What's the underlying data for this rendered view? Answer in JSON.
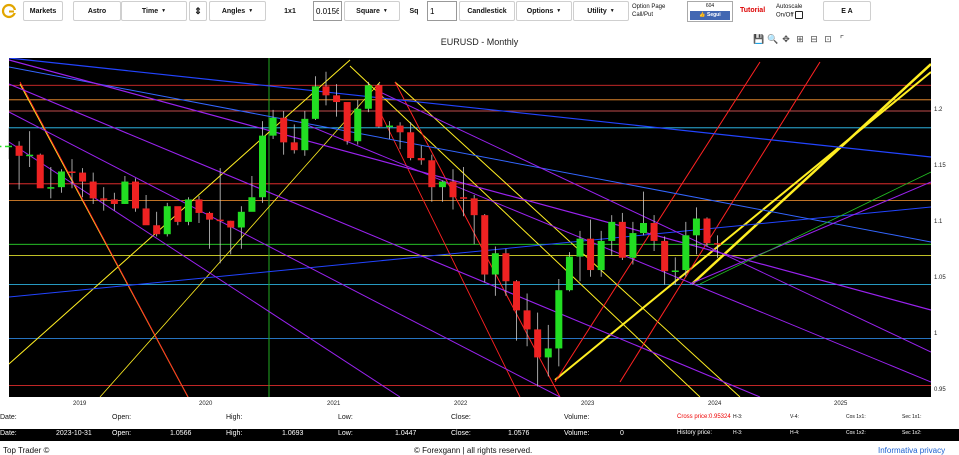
{
  "toolbar": {
    "markets": "Markets",
    "astro": "Astro",
    "time": "Time",
    "stepper": "⇕",
    "angles": "Angles",
    "ratio": "1x1",
    "ratio_value": "0.01562",
    "square": "Square",
    "sq_label": "Sq",
    "sq_value": "1",
    "candlestick": "Candlestick",
    "options": "Options",
    "utility": "Utility",
    "option_page_line1": "Option Page",
    "option_page_line2": "Call/Put",
    "fb_count": "604",
    "fb_button": "👍 Segui",
    "tutorial": "Tutorial",
    "autoscale_line1": "Autoscale",
    "autoscale_line2": "On/Off",
    "ea": "E A"
  },
  "chart": {
    "title": "EURUSD - Monthly",
    "tools": [
      "💾",
      "🔍",
      "✥",
      "⊞",
      "⊟",
      "⊡",
      "⌜"
    ]
  },
  "chart_data": {
    "type": "candlestick",
    "symbol": "EURUSD",
    "timeframe": "Monthly",
    "y_ticks": [
      "1.2",
      "1.15",
      "1.1",
      "1.05",
      "1",
      "0.95"
    ],
    "x_ticks": [
      "2019",
      "2020",
      "2021",
      "2022",
      "2023",
      "2024",
      "2025"
    ],
    "ylim": [
      0.945,
      1.245
    ],
    "x_range": [
      "2018-04",
      "2025-12"
    ],
    "candles": [
      {
        "t": "2018-05",
        "o": 1.169,
        "h": 1.182,
        "l": 1.152,
        "c": 1.169
      },
      {
        "t": "2018-06",
        "o": 1.169,
        "h": 1.18,
        "l": 1.151,
        "c": 1.169
      },
      {
        "t": "2018-07",
        "o": 1.169,
        "h": 1.185,
        "l": 1.157,
        "c": 1.169
      },
      {
        "t": "2018-08",
        "o": 1.169,
        "h": 1.173,
        "l": 1.13,
        "c": 1.16
      },
      {
        "t": "2018-09",
        "o": 1.16,
        "h": 1.182,
        "l": 1.15,
        "c": 1.161
      },
      {
        "t": "2018-10",
        "o": 1.161,
        "h": 1.162,
        "l": 1.132,
        "c": 1.131
      },
      {
        "t": "2018-11",
        "o": 1.131,
        "h": 1.15,
        "l": 1.122,
        "c": 1.132
      },
      {
        "t": "2018-12",
        "o": 1.132,
        "h": 1.148,
        "l": 1.127,
        "c": 1.146
      },
      {
        "t": "2019-01",
        "o": 1.146,
        "h": 1.157,
        "l": 1.131,
        "c": 1.145
      },
      {
        "t": "2019-02",
        "o": 1.145,
        "h": 1.149,
        "l": 1.123,
        "c": 1.137
      },
      {
        "t": "2019-03",
        "o": 1.137,
        "h": 1.145,
        "l": 1.117,
        "c": 1.122
      },
      {
        "t": "2019-04",
        "o": 1.122,
        "h": 1.132,
        "l": 1.111,
        "c": 1.121
      },
      {
        "t": "2019-05",
        "o": 1.121,
        "h": 1.127,
        "l": 1.111,
        "c": 1.117
      },
      {
        "t": "2019-06",
        "o": 1.117,
        "h": 1.142,
        "l": 1.117,
        "c": 1.137
      },
      {
        "t": "2019-07",
        "o": 1.137,
        "h": 1.14,
        "l": 1.11,
        "c": 1.113
      },
      {
        "t": "2019-08",
        "o": 1.113,
        "h": 1.125,
        "l": 1.103,
        "c": 1.098
      },
      {
        "t": "2019-09",
        "o": 1.098,
        "h": 1.11,
        "l": 1.088,
        "c": 1.09
      },
      {
        "t": "2019-10",
        "o": 1.09,
        "h": 1.118,
        "l": 1.088,
        "c": 1.115
      },
      {
        "t": "2019-11",
        "o": 1.115,
        "h": 1.114,
        "l": 1.098,
        "c": 1.101
      },
      {
        "t": "2019-12",
        "o": 1.101,
        "h": 1.123,
        "l": 1.098,
        "c": 1.121
      },
      {
        "t": "2020-01",
        "o": 1.121,
        "h": 1.124,
        "l": 1.1,
        "c": 1.109
      },
      {
        "t": "2020-02",
        "o": 1.109,
        "h": 1.11,
        "l": 1.077,
        "c": 1.103
      },
      {
        "t": "2020-03",
        "o": 1.103,
        "h": 1.149,
        "l": 1.064,
        "c": 1.102
      },
      {
        "t": "2020-04",
        "o": 1.102,
        "h": 1.102,
        "l": 1.072,
        "c": 1.096
      },
      {
        "t": "2020-05",
        "o": 1.096,
        "h": 1.115,
        "l": 1.077,
        "c": 1.11
      },
      {
        "t": "2020-06",
        "o": 1.11,
        "h": 1.142,
        "l": 1.117,
        "c": 1.123
      },
      {
        "t": "2020-07",
        "o": 1.123,
        "h": 1.191,
        "l": 1.118,
        "c": 1.178
      },
      {
        "t": "2020-08",
        "o": 1.178,
        "h": 1.201,
        "l": 1.175,
        "c": 1.194
      },
      {
        "t": "2020-09",
        "o": 1.194,
        "h": 1.2,
        "l": 1.161,
        "c": 1.172
      },
      {
        "t": "2020-10",
        "o": 1.172,
        "h": 1.188,
        "l": 1.162,
        "c": 1.165
      },
      {
        "t": "2020-11",
        "o": 1.165,
        "h": 1.2,
        "l": 1.16,
        "c": 1.193
      },
      {
        "t": "2020-12",
        "o": 1.193,
        "h": 1.231,
        "l": 1.192,
        "c": 1.222
      },
      {
        "t": "2021-01",
        "o": 1.222,
        "h": 1.235,
        "l": 1.205,
        "c": 1.214
      },
      {
        "t": "2021-02",
        "o": 1.214,
        "h": 1.224,
        "l": 1.195,
        "c": 1.208
      },
      {
        "t": "2021-03",
        "o": 1.208,
        "h": 1.199,
        "l": 1.17,
        "c": 1.173
      },
      {
        "t": "2021-04",
        "o": 1.173,
        "h": 1.21,
        "l": 1.17,
        "c": 1.202
      },
      {
        "t": "2021-05",
        "o": 1.202,
        "h": 1.226,
        "l": 1.199,
        "c": 1.223
      },
      {
        "t": "2021-06",
        "o": 1.223,
        "h": 1.225,
        "l": 1.185,
        "c": 1.186
      },
      {
        "t": "2021-07",
        "o": 1.186,
        "h": 1.191,
        "l": 1.175,
        "c": 1.187
      },
      {
        "t": "2021-08",
        "o": 1.187,
        "h": 1.19,
        "l": 1.166,
        "c": 1.181
      },
      {
        "t": "2021-09",
        "o": 1.181,
        "h": 1.19,
        "l": 1.156,
        "c": 1.158
      },
      {
        "t": "2021-10",
        "o": 1.158,
        "h": 1.169,
        "l": 1.152,
        "c": 1.156
      },
      {
        "t": "2021-11",
        "o": 1.156,
        "h": 1.161,
        "l": 1.119,
        "c": 1.132
      },
      {
        "t": "2021-12",
        "o": 1.132,
        "h": 1.138,
        "l": 1.119,
        "c": 1.137
      },
      {
        "t": "2022-01",
        "o": 1.137,
        "h": 1.148,
        "l": 1.112,
        "c": 1.123
      },
      {
        "t": "2022-02",
        "o": 1.123,
        "h": 1.15,
        "l": 1.106,
        "c": 1.122
      },
      {
        "t": "2022-03",
        "o": 1.122,
        "h": 1.125,
        "l": 1.081,
        "c": 1.107
      },
      {
        "t": "2022-04",
        "o": 1.107,
        "h": 1.108,
        "l": 1.047,
        "c": 1.054
      },
      {
        "t": "2022-05",
        "o": 1.054,
        "h": 1.079,
        "l": 1.035,
        "c": 1.073
      },
      {
        "t": "2022-06",
        "o": 1.073,
        "h": 1.077,
        "l": 1.035,
        "c": 1.048
      },
      {
        "t": "2022-07",
        "o": 1.048,
        "h": 1.049,
        "l": 0.995,
        "c": 1.022
      },
      {
        "t": "2022-08",
        "o": 1.022,
        "h": 1.037,
        "l": 0.99,
        "c": 1.005
      },
      {
        "t": "2022-09",
        "o": 1.005,
        "h": 1.02,
        "l": 0.954,
        "c": 0.98
      },
      {
        "t": "2022-10",
        "o": 0.98,
        "h": 1.009,
        "l": 0.963,
        "c": 0.988
      },
      {
        "t": "2022-11",
        "o": 0.988,
        "h": 1.05,
        "l": 0.972,
        "c": 1.04
      },
      {
        "t": "2022-12",
        "o": 1.04,
        "h": 1.074,
        "l": 1.039,
        "c": 1.07
      },
      {
        "t": "2023-01",
        "o": 1.07,
        "h": 1.093,
        "l": 1.048,
        "c": 1.086
      },
      {
        "t": "2023-02",
        "o": 1.086,
        "h": 1.103,
        "l": 1.052,
        "c": 1.058
      },
      {
        "t": "2023-03",
        "o": 1.058,
        "h": 1.093,
        "l": 1.052,
        "c": 1.084
      },
      {
        "t": "2023-04",
        "o": 1.084,
        "h": 1.107,
        "l": 1.071,
        "c": 1.101
      },
      {
        "t": "2023-05",
        "o": 1.101,
        "h": 1.109,
        "l": 1.067,
        "c": 1.069
      },
      {
        "t": "2023-06",
        "o": 1.069,
        "h": 1.101,
        "l": 1.063,
        "c": 1.091
      },
      {
        "t": "2023-07",
        "o": 1.091,
        "h": 1.128,
        "l": 1.089,
        "c": 1.1
      },
      {
        "t": "2023-08",
        "o": 1.1,
        "h": 1.107,
        "l": 1.075,
        "c": 1.084
      },
      {
        "t": "2023-09",
        "o": 1.084,
        "h": 1.088,
        "l": 1.045,
        "c": 1.057
      },
      {
        "t": "2023-10",
        "o": 1.0566,
        "h": 1.0693,
        "l": 1.0447,
        "c": 1.0576
      },
      {
        "t": "2023-11",
        "o": 1.058,
        "h": 1.101,
        "l": 1.052,
        "c": 1.089
      },
      {
        "t": "2023-12",
        "o": 1.089,
        "h": 1.114,
        "l": 1.072,
        "c": 1.104
      },
      {
        "t": "2024-01",
        "o": 1.104,
        "h": 1.105,
        "l": 1.079,
        "c": 1.082
      },
      {
        "t": "2024-02",
        "o": 1.082,
        "h": 1.089,
        "l": 1.069,
        "c": 1.081
      }
    ]
  },
  "info_row1": {
    "date_label": "Date:",
    "open_label": "Open:",
    "high_label": "High:",
    "low_label": "Low:",
    "close_label": "Close:",
    "volume_label": "Volume:",
    "cross_price": "Cross price:0.95324",
    "h3": "H-3:",
    "v4": "V-4:",
    "cos1": "Cos 1x1:",
    "sec1": "Sec 1x1:"
  },
  "info_row2": {
    "date_label": "Date:",
    "date_value": "2023-10-31",
    "open_label": "Open:",
    "open_value": "1.0566",
    "high_label": "High:",
    "high_value": "1.0693",
    "low_label": "Low:",
    "low_value": "1.0447",
    "close_label": "Close:",
    "close_value": "1.0576",
    "volume_label": "Volume:",
    "volume_value": "0",
    "history_price": "History price:",
    "h3": "H-3:",
    "h4": "H-4:",
    "cos2": "Cos 1x2:",
    "sec2": "Sec 1x2:"
  },
  "footer": {
    "left": "Top Trader ©",
    "center": "© Forexgann | all rights reserved.",
    "right": "Informativa privacy"
  },
  "colors": {
    "chart_bg": "#000000",
    "bull": "#22dd22",
    "bear": "#ee2222",
    "tutorial": "#dd0000",
    "link": "#1a5fd0"
  }
}
